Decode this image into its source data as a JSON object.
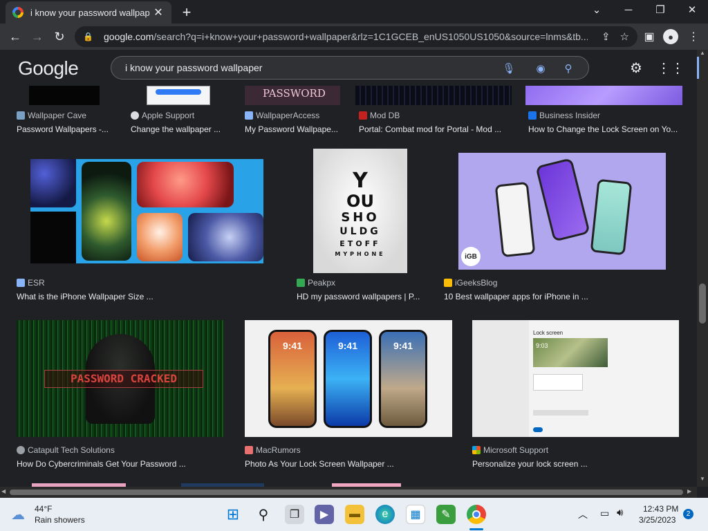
{
  "browser": {
    "tab_title": "i know your password wallpaper",
    "url_domain": "google.com",
    "url_path": "/search?q=i+know+your+password+wallpaper&rlz=1C1GCEB_enUS1050US1050&source=lnms&tb..."
  },
  "google": {
    "logo": "Google",
    "query": "i know your password wallpaper"
  },
  "results_row1": [
    {
      "source": "Wallpaper Cave",
      "title": "Password Wallpapers -..."
    },
    {
      "source": "Apple Support",
      "title": "Change the wallpaper ..."
    },
    {
      "source": "WallpaperAccess",
      "title": "My Password Wallpape..."
    },
    {
      "source": "Mod DB",
      "title": "Portal: Combat mod for Portal - Mod ..."
    },
    {
      "source": "Business Insider",
      "title": "How to Change the Lock Screen on Yo..."
    }
  ],
  "results_row2": [
    {
      "source": "ESR",
      "title": "What is the iPhone Wallpaper Size ..."
    },
    {
      "source": "Peakpx",
      "title": "HD my password wallpapers | P..."
    },
    {
      "source": "iGeeksBlog",
      "title": "10 Best wallpaper apps for iPhone in ..."
    }
  ],
  "results_row3": [
    {
      "source": "Catapult Tech Solutions",
      "title": "How Do Cybercriminals Get Your Password ..."
    },
    {
      "source": "MacRumors",
      "title": "Photo As Your Lock Screen Wallpaper ..."
    },
    {
      "source": "Microsoft Support",
      "title": "Personalize your lock screen ..."
    }
  ],
  "thumb_text": {
    "password_card": "PASSWORD",
    "eye_chart": [
      "Y",
      "OU",
      "SHO",
      "ULDG",
      "ETOFF",
      "MYPHONE"
    ],
    "igb_badge": "iGB",
    "cracked": "PASSWORD CRACKED",
    "phone_time": "9:41",
    "ms_heading": "Lock screen",
    "ms_time": "9:03"
  },
  "taskbar": {
    "temp": "44°F",
    "weather": "Rain showers",
    "time": "12:43 PM",
    "date": "3/25/2023",
    "notif_count": "2"
  }
}
